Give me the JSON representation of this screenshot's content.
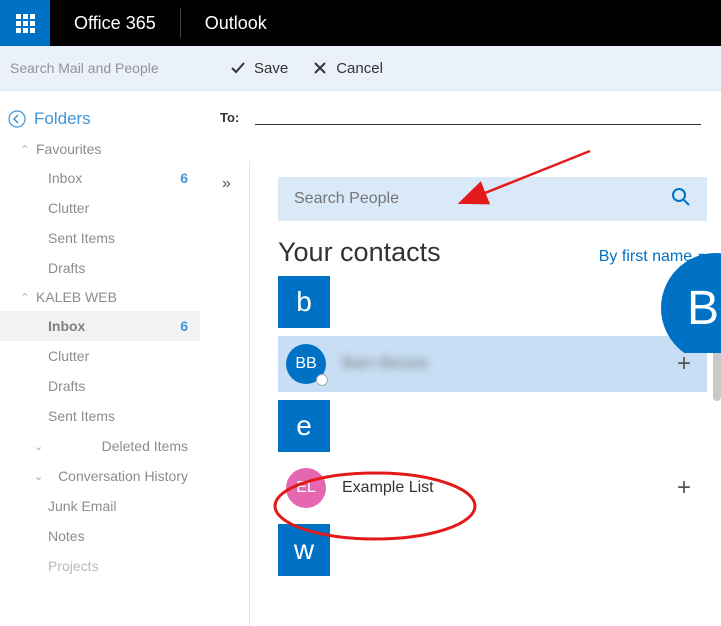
{
  "topbar": {
    "brand": "Office 365",
    "app": "Outlook"
  },
  "toolbar": {
    "search_placeholder": "Search Mail and People",
    "save_label": "Save",
    "cancel_label": "Cancel"
  },
  "sidebar": {
    "folders_label": "Folders",
    "groups": [
      {
        "label": "Favourites",
        "items": [
          {
            "label": "Inbox",
            "count": "6"
          },
          {
            "label": "Clutter"
          },
          {
            "label": "Sent Items"
          },
          {
            "label": "Drafts"
          }
        ]
      },
      {
        "label": "KALEB WEB",
        "items": [
          {
            "label": "Inbox",
            "count": "6",
            "active": true
          },
          {
            "label": "Clutter"
          },
          {
            "label": "Drafts"
          },
          {
            "label": "Sent Items"
          },
          {
            "label": "Deleted Items",
            "expandable": true
          },
          {
            "label": "Conversation History",
            "expandable": true
          },
          {
            "label": "Junk Email"
          },
          {
            "label": "Notes"
          },
          {
            "label": "Projects"
          }
        ]
      }
    ]
  },
  "compose": {
    "to_label": "To:"
  },
  "people_picker": {
    "search_placeholder": "Search People",
    "heading": "Your contacts",
    "sort_label": "By first name",
    "letters": {
      "b": "b",
      "e": "e",
      "w": "w"
    },
    "contacts": [
      {
        "initials": "BB",
        "name": "Barn Bessie",
        "color": "#0072c6",
        "selected": true,
        "blurred": true
      },
      {
        "initials": "EL",
        "name": "Example List",
        "color": "#e667af",
        "selected": false
      }
    ],
    "preview_initial": "B"
  }
}
